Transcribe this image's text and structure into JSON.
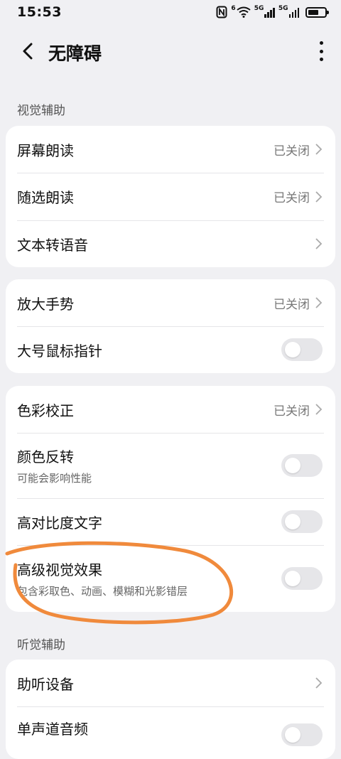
{
  "status_bar": {
    "time": "15:53",
    "net1_label": "6",
    "net2_label": "5G",
    "net3_label": "5G"
  },
  "header": {
    "title": "无障碍"
  },
  "sections": {
    "visual_label": "视觉辅助",
    "hearing_label": "听觉辅助"
  },
  "card1": [
    {
      "title": "屏幕朗读",
      "value": "已关闭"
    },
    {
      "title": "随选朗读",
      "value": "已关闭"
    },
    {
      "title": "文本转语音",
      "value": ""
    }
  ],
  "card2": [
    {
      "title": "放大手势",
      "value": "已关闭"
    },
    {
      "title": "大号鼠标指针",
      "toggle": false
    }
  ],
  "card3": [
    {
      "title": "色彩校正",
      "value": "已关闭"
    },
    {
      "title": "颜色反转",
      "subtitle": "可能会影响性能",
      "toggle": false
    },
    {
      "title": "高对比度文字",
      "toggle": false
    },
    {
      "title": "高级视觉效果",
      "subtitle": "包含彩取色、动画、模糊和光影错层",
      "toggle": false
    }
  ],
  "card4": [
    {
      "title": "助听设备",
      "value": ""
    },
    {
      "title": "单声道音频",
      "toggle": false
    }
  ],
  "colors": {
    "background": "#f0f0f3",
    "card": "#ffffff",
    "annotation": "#f08a3c"
  }
}
